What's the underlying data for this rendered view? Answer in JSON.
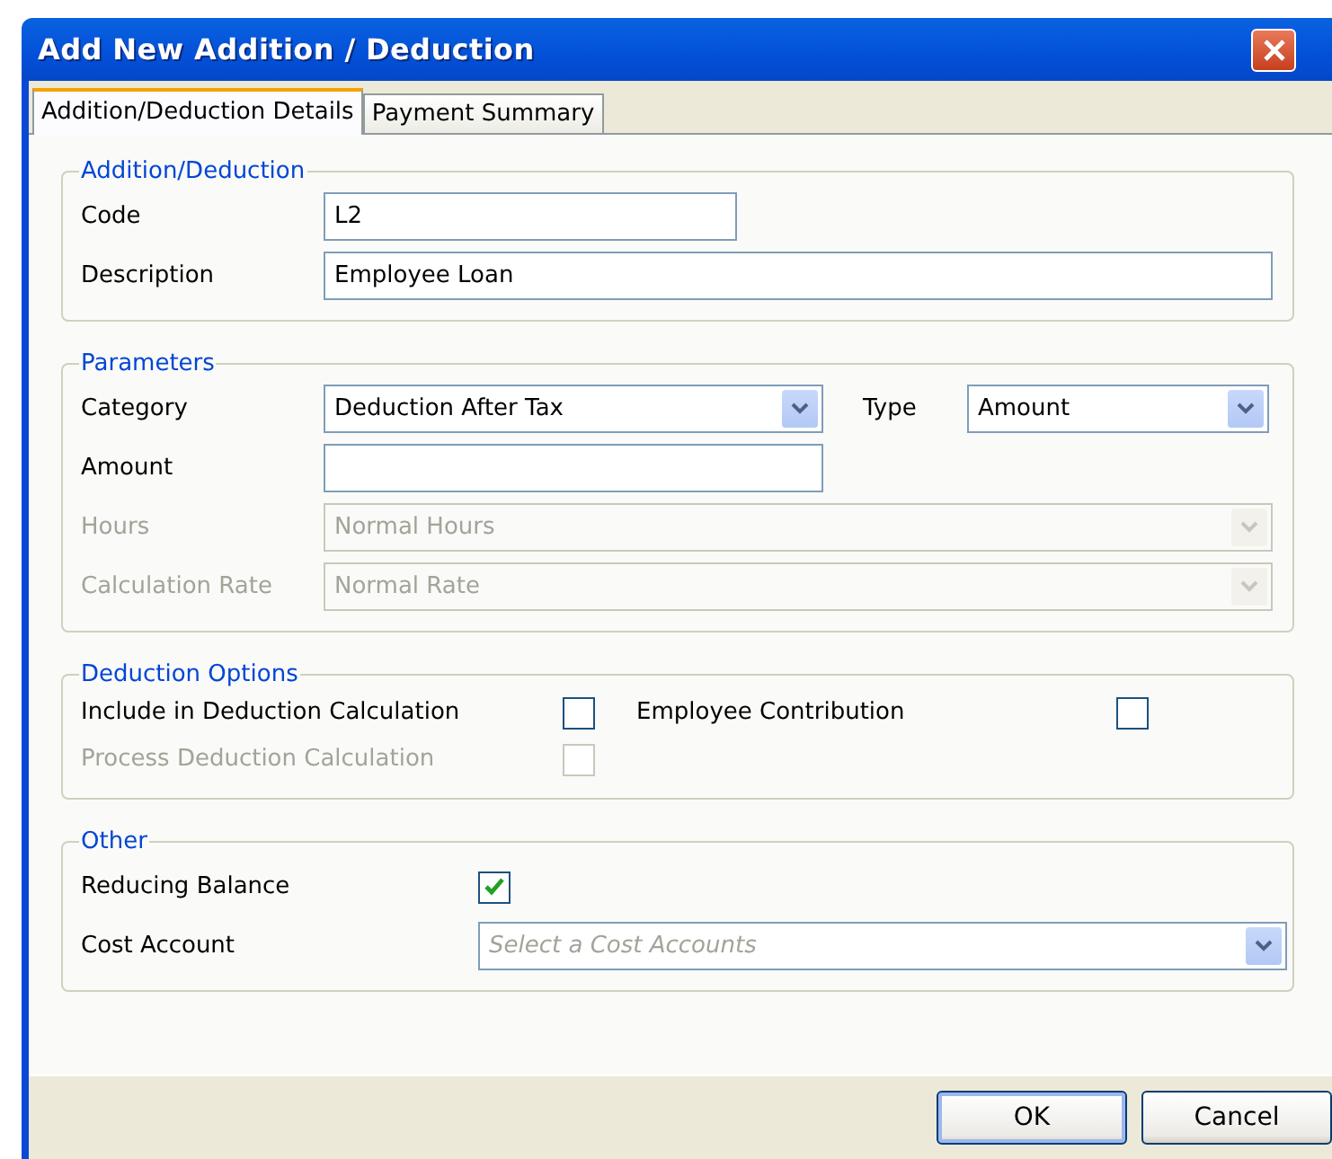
{
  "window": {
    "title": "Add New Addition / Deduction"
  },
  "tabs": [
    {
      "label": "Addition/Deduction Details",
      "selected": true
    },
    {
      "label": "Payment Summary",
      "selected": false
    }
  ],
  "groups": [
    {
      "title": "Addition/Deduction",
      "rows": [
        [
          {
            "kind": "text",
            "label": "Code",
            "value": "L2",
            "disabled": false
          }
        ],
        [
          {
            "kind": "text",
            "label": "Description",
            "value": "Employee Loan",
            "disabled": false
          }
        ]
      ]
    },
    {
      "title": "Parameters",
      "rows": [
        [
          {
            "kind": "select",
            "label": "Category",
            "value": "Deduction After Tax",
            "disabled": false
          },
          {
            "kind": "select",
            "label": "Type",
            "value": "Amount",
            "disabled": false
          }
        ],
        [
          {
            "kind": "text",
            "label": "Amount",
            "disabled": false
          }
        ],
        [
          {
            "kind": "select",
            "label": "Hours",
            "value": "Normal Hours",
            "disabled": true
          }
        ],
        [
          {
            "kind": "select",
            "label": "Calculation Rate",
            "value": "Normal Rate",
            "disabled": true
          }
        ]
      ]
    },
    {
      "title": "Deduction Options",
      "rows": [
        [
          {
            "kind": "checkbox",
            "label": "Include in Deduction Calculation",
            "checked": false,
            "disabled": false
          },
          {
            "kind": "checkbox",
            "label": "Employee Contribution",
            "checked": false,
            "disabled": false
          }
        ],
        [
          {
            "kind": "checkbox",
            "label": "Process Deduction Calculation",
            "checked": false,
            "disabled": true
          }
        ]
      ]
    },
    {
      "title": "Other",
      "rows": [
        [
          {
            "kind": "checkbox",
            "label": "Reducing Balance",
            "checked": true,
            "disabled": false
          }
        ],
        [
          {
            "kind": "select",
            "label": "Cost Account",
            "placeholder": "Select a Cost Accounts",
            "disabled": false
          }
        ]
      ]
    }
  ],
  "buttons": [
    {
      "label": "OK",
      "kind": "default"
    },
    {
      "label": "Cancel",
      "kind": "normal"
    }
  ]
}
